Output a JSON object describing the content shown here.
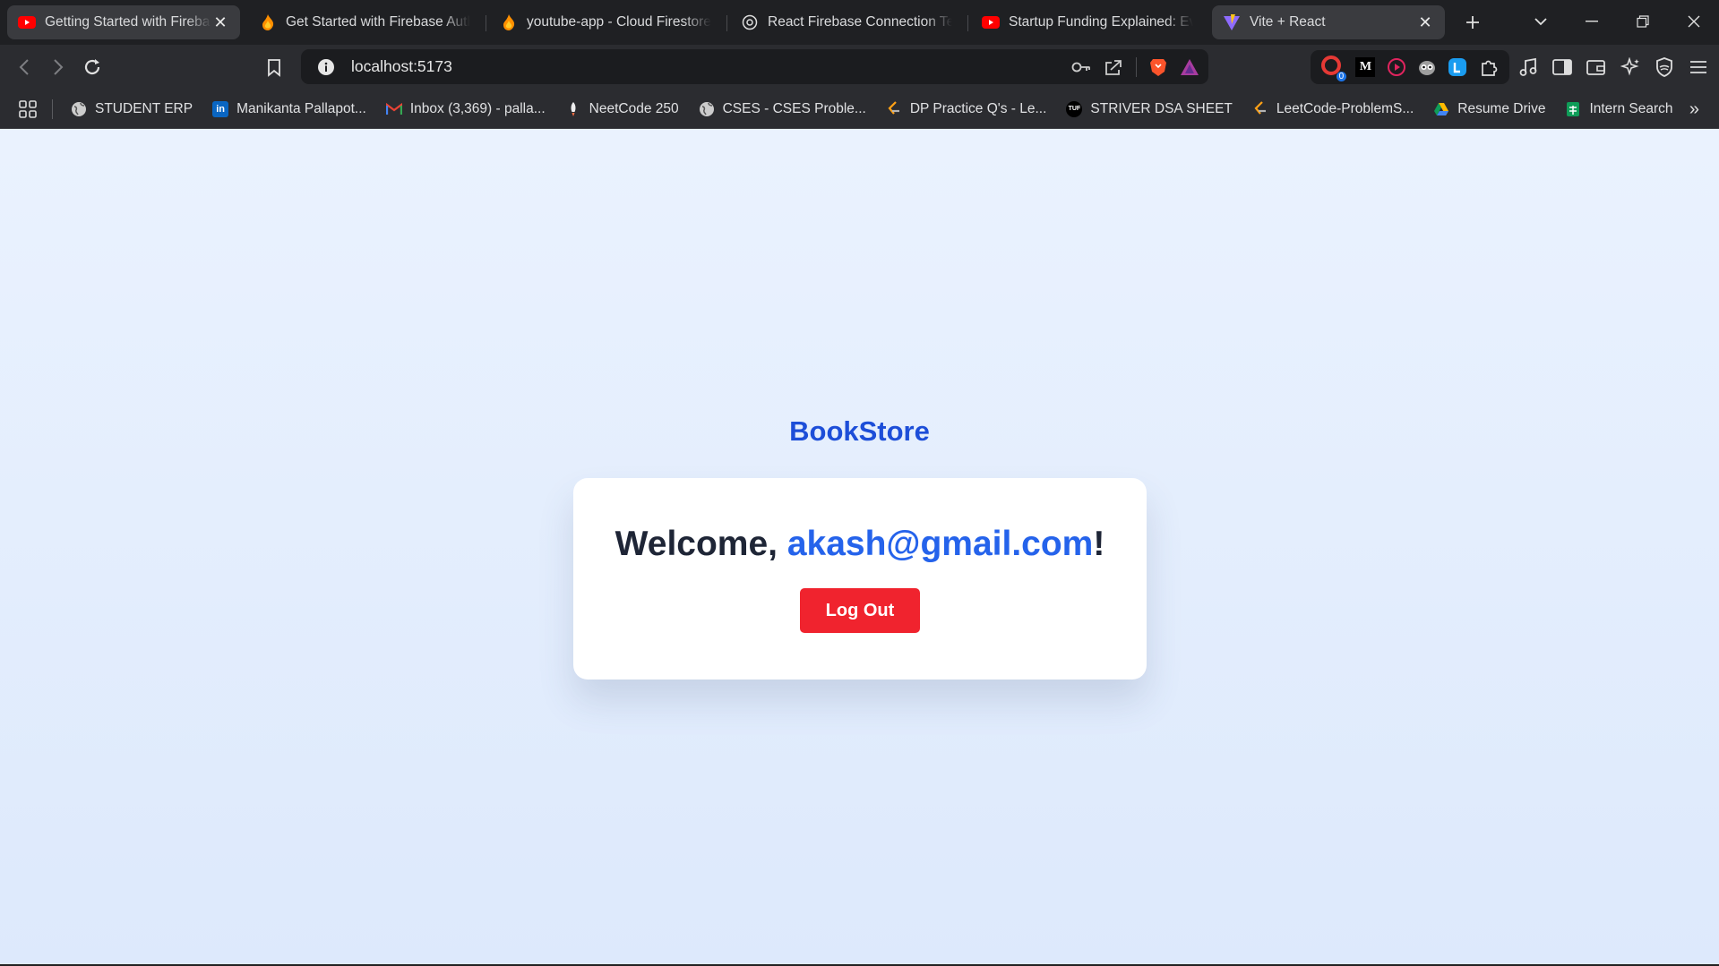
{
  "tabs": [
    {
      "title": "Getting Started with Fireba",
      "icon": "youtube-icon",
      "close": "✕"
    },
    {
      "title": "Get Started with Firebase Authe",
      "icon": "firebase-icon"
    },
    {
      "title": "youtube-app - Cloud Firestore",
      "icon": "firebase-icon"
    },
    {
      "title": "React Firebase Connection Test",
      "icon": "globe-icon"
    },
    {
      "title": "Startup Funding Explained: Ever",
      "icon": "youtube-icon"
    },
    {
      "title": "Vite + React",
      "icon": "vite-icon",
      "close": "✕"
    }
  ],
  "toolbar": {
    "url": "localhost:5173"
  },
  "bookmarks": [
    {
      "label": "STUDENT ERP",
      "icon": "globe-icon"
    },
    {
      "label": "Manikanta Pallapot...",
      "icon": "linkedin-icon"
    },
    {
      "label": "Inbox (3,369) - palla...",
      "icon": "gmail-icon"
    },
    {
      "label": "NeetCode 250",
      "icon": "rocket-icon"
    },
    {
      "label": "CSES - CSES Proble...",
      "icon": "globe-icon"
    },
    {
      "label": "DP Practice Q's - Le...",
      "icon": "leetcode-icon"
    },
    {
      "label": "STRIVER DSA SHEET",
      "icon": "tuf-icon"
    },
    {
      "label": "LeetCode-ProblemS...",
      "icon": "leetcode-icon"
    },
    {
      "label": "Resume Drive",
      "icon": "drive-icon"
    },
    {
      "label": "Intern Search",
      "icon": "sheets-icon"
    }
  ],
  "extensions": {
    "badge_count": "0",
    "medium_letter": "M"
  },
  "page": {
    "brand": "BookStore",
    "welcome_prefix": "Welcome, ",
    "user_email": "akash@gmail.com",
    "welcome_suffix": "!",
    "logout_label": "Log Out"
  },
  "colors": {
    "brand": "#1d4ed8",
    "email": "#2563eb",
    "logout": "#f0232e",
    "background": "#eaf2fe"
  }
}
